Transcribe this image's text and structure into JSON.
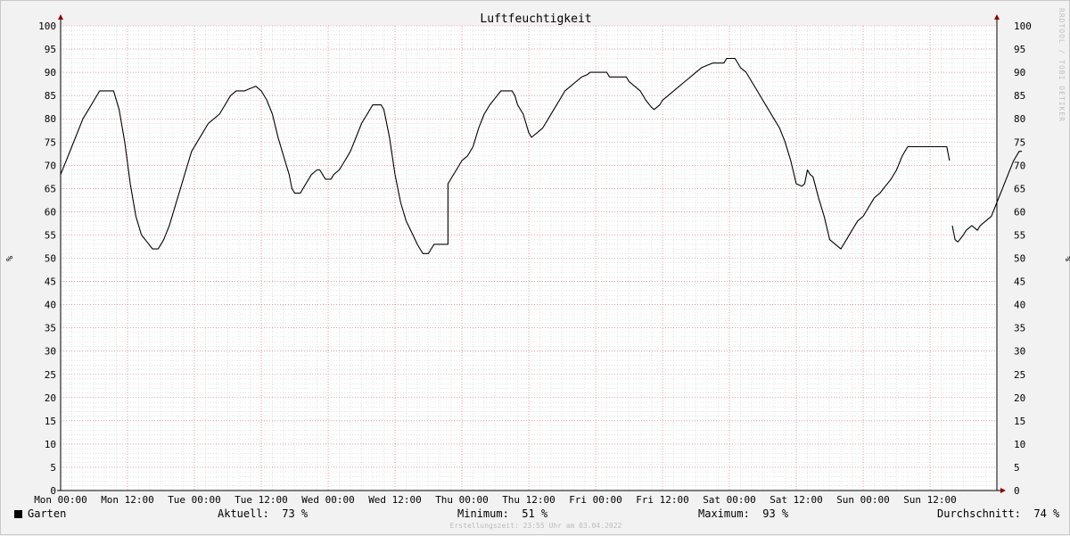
{
  "watermark": "RRDTOOL / TOBI OETIKER",
  "legend": {
    "series_name": "Garten",
    "series_color": "#000000",
    "current_label": "Aktuell:",
    "current_value": "73 %",
    "min_label": "Minimum:",
    "min_value": "51 %",
    "max_label": "Maximum:",
    "max_value": "93 %",
    "avg_label": "Durchschnitt:",
    "avg_value": "74 %"
  },
  "footer": "Erstellungszeit: 23:55 Uhr am 03.04.2022",
  "colors": {
    "background": "#f2f2f2",
    "canvas": "#ffffff",
    "major_grid": "#e06070",
    "minor_grid": "#c8c8c8",
    "axis_arrow": "#8b0000",
    "line": "#000000"
  },
  "chart_data": {
    "type": "line",
    "title": "Luftfeuchtigkeit",
    "ylabel": "%",
    "ylim": [
      0,
      100
    ],
    "yticks": [
      0,
      5,
      10,
      15,
      20,
      25,
      30,
      35,
      40,
      45,
      50,
      55,
      60,
      65,
      70,
      75,
      80,
      85,
      90,
      95,
      100
    ],
    "xlim": [
      0,
      168
    ],
    "x_unit": "hours since Mon 00:00",
    "xticks": [
      0,
      12,
      24,
      36,
      48,
      60,
      72,
      84,
      96,
      108,
      120,
      132,
      144,
      156
    ],
    "xtick_labels": [
      "Mon 00:00",
      "Mon 12:00",
      "Tue 00:00",
      "Tue 12:00",
      "Wed 00:00",
      "Wed 12:00",
      "Thu 00:00",
      "Thu 12:00",
      "Fri 00:00",
      "Fri 12:00",
      "Sat 00:00",
      "Sat 12:00",
      "Sun 00:00",
      "Sun 12:00"
    ],
    "grid": true,
    "right_axis_mirrored": true,
    "series": [
      {
        "name": "Garten",
        "color": "#000000",
        "segments": [
          [
            [
              0,
              68
            ],
            [
              1,
              71
            ],
            [
              2,
              74
            ],
            [
              3,
              77
            ],
            [
              4,
              80
            ],
            [
              5,
              82
            ],
            [
              6,
              84
            ],
            [
              7,
              86
            ],
            [
              8,
              86
            ],
            [
              9.5,
              86
            ],
            [
              10.5,
              82
            ],
            [
              11.5,
              75
            ],
            [
              12.5,
              66
            ],
            [
              13.5,
              59
            ],
            [
              14.5,
              55
            ],
            [
              15.5,
              53.5
            ],
            [
              16.5,
              52
            ],
            [
              17.5,
              52
            ],
            [
              18.5,
              54
            ],
            [
              19.5,
              57
            ],
            [
              20.5,
              61
            ],
            [
              21.5,
              65
            ],
            [
              22.5,
              69
            ],
            [
              23.5,
              73
            ],
            [
              24.5,
              75
            ],
            [
              25.5,
              77
            ],
            [
              26.5,
              79
            ],
            [
              27.5,
              80
            ],
            [
              28.5,
              81
            ],
            [
              29.5,
              83
            ],
            [
              30.5,
              85
            ],
            [
              31.5,
              86
            ],
            [
              33,
              86
            ],
            [
              34,
              86.5
            ],
            [
              35,
              87
            ],
            [
              36,
              86
            ],
            [
              37,
              84
            ],
            [
              38,
              81
            ],
            [
              39,
              76
            ],
            [
              40,
              72
            ],
            [
              41,
              68
            ],
            [
              41.5,
              65
            ],
            [
              42,
              64
            ],
            [
              43,
              64
            ],
            [
              44,
              66
            ],
            [
              45,
              68
            ],
            [
              46,
              69
            ],
            [
              46.5,
              69
            ],
            [
              47,
              68
            ],
            [
              47.5,
              67
            ],
            [
              48.5,
              67
            ],
            [
              49,
              68
            ],
            [
              50,
              69
            ],
            [
              51,
              71
            ],
            [
              52,
              73
            ],
            [
              53,
              76
            ],
            [
              54,
              79
            ],
            [
              55,
              81
            ],
            [
              56,
              83
            ],
            [
              57.5,
              83
            ],
            [
              58,
              82
            ],
            [
              59,
              76
            ],
            [
              60,
              68
            ],
            [
              61,
              62
            ],
            [
              62,
              58
            ],
            [
              63,
              55.5
            ],
            [
              64,
              53
            ],
            [
              64.5,
              52
            ],
            [
              65,
              51
            ],
            [
              66,
              51
            ],
            [
              66.5,
              52
            ],
            [
              67,
              53
            ],
            [
              69,
              53
            ],
            [
              69.5,
              53
            ],
            [
              69.5,
              66
            ],
            [
              70,
              67
            ],
            [
              71,
              69
            ],
            [
              72,
              71
            ],
            [
              73,
              72
            ],
            [
              74,
              74
            ],
            [
              75,
              78
            ],
            [
              76,
              81
            ],
            [
              77,
              83
            ],
            [
              78,
              84.5
            ],
            [
              79,
              86
            ],
            [
              81,
              86
            ],
            [
              81.5,
              85
            ],
            [
              82,
              83
            ],
            [
              83,
              81
            ],
            [
              83.5,
              79
            ],
            [
              84,
              77
            ],
            [
              84.5,
              76
            ],
            [
              85.5,
              77
            ],
            [
              86.5,
              78
            ],
            [
              87.5,
              80
            ],
            [
              88.5,
              82
            ],
            [
              89.5,
              84
            ],
            [
              90.5,
              86
            ],
            [
              91.5,
              87
            ],
            [
              92.5,
              88
            ],
            [
              93.5,
              89
            ],
            [
              94.5,
              89.5
            ],
            [
              95,
              90
            ],
            [
              98,
              90
            ],
            [
              98.5,
              89
            ],
            [
              101.5,
              89
            ],
            [
              102,
              88
            ],
            [
              103,
              87
            ],
            [
              104,
              86
            ],
            [
              105,
              84
            ],
            [
              106,
              82.5
            ],
            [
              106.5,
              82
            ],
            [
              107.5,
              83
            ],
            [
              108,
              84
            ],
            [
              109,
              85
            ],
            [
              110,
              86
            ],
            [
              111,
              87
            ],
            [
              112,
              88
            ],
            [
              113,
              89
            ],
            [
              114,
              90
            ],
            [
              115,
              91
            ],
            [
              116,
              91.5
            ],
            [
              117,
              92
            ],
            [
              119,
              92
            ],
            [
              119.5,
              93
            ],
            [
              121,
              93
            ],
            [
              122,
              91
            ],
            [
              123,
              90
            ],
            [
              124,
              88
            ],
            [
              125,
              86
            ],
            [
              126,
              84
            ],
            [
              127,
              82
            ],
            [
              128,
              80
            ],
            [
              129,
              78
            ],
            [
              130,
              75
            ],
            [
              131,
              71
            ],
            [
              132,
              66
            ],
            [
              133,
              65.5
            ],
            [
              133.5,
              66
            ],
            [
              134,
              69
            ],
            [
              134.5,
              68
            ],
            [
              135,
              67.5
            ],
            [
              136,
              63
            ],
            [
              137,
              59
            ],
            [
              138,
              54
            ],
            [
              139,
              53
            ],
            [
              140,
              52
            ],
            [
              141,
              54
            ],
            [
              142,
              56
            ],
            [
              143,
              58
            ],
            [
              144,
              59
            ],
            [
              145,
              61
            ],
            [
              146,
              63
            ],
            [
              147,
              64
            ],
            [
              148,
              65.5
            ],
            [
              149,
              67
            ],
            [
              150,
              69
            ],
            [
              151,
              72
            ],
            [
              152,
              74
            ],
            [
              159,
              74
            ],
            [
              159.5,
              71
            ]
          ],
          [
            [
              160,
              57
            ],
            [
              160.5,
              54
            ],
            [
              161,
              53.5
            ],
            [
              162,
              55
            ],
            [
              162.5,
              56
            ],
            [
              163,
              56.5
            ],
            [
              163.5,
              57
            ],
            [
              164,
              56.5
            ],
            [
              164.5,
              56
            ],
            [
              165,
              57
            ],
            [
              166,
              58
            ],
            [
              167,
              59
            ],
            [
              168,
              62
            ],
            [
              169,
              65
            ],
            [
              170,
              68
            ],
            [
              171,
              71
            ],
            [
              172,
              73
            ],
            [
              172.5,
              73
            ]
          ]
        ]
      }
    ]
  }
}
